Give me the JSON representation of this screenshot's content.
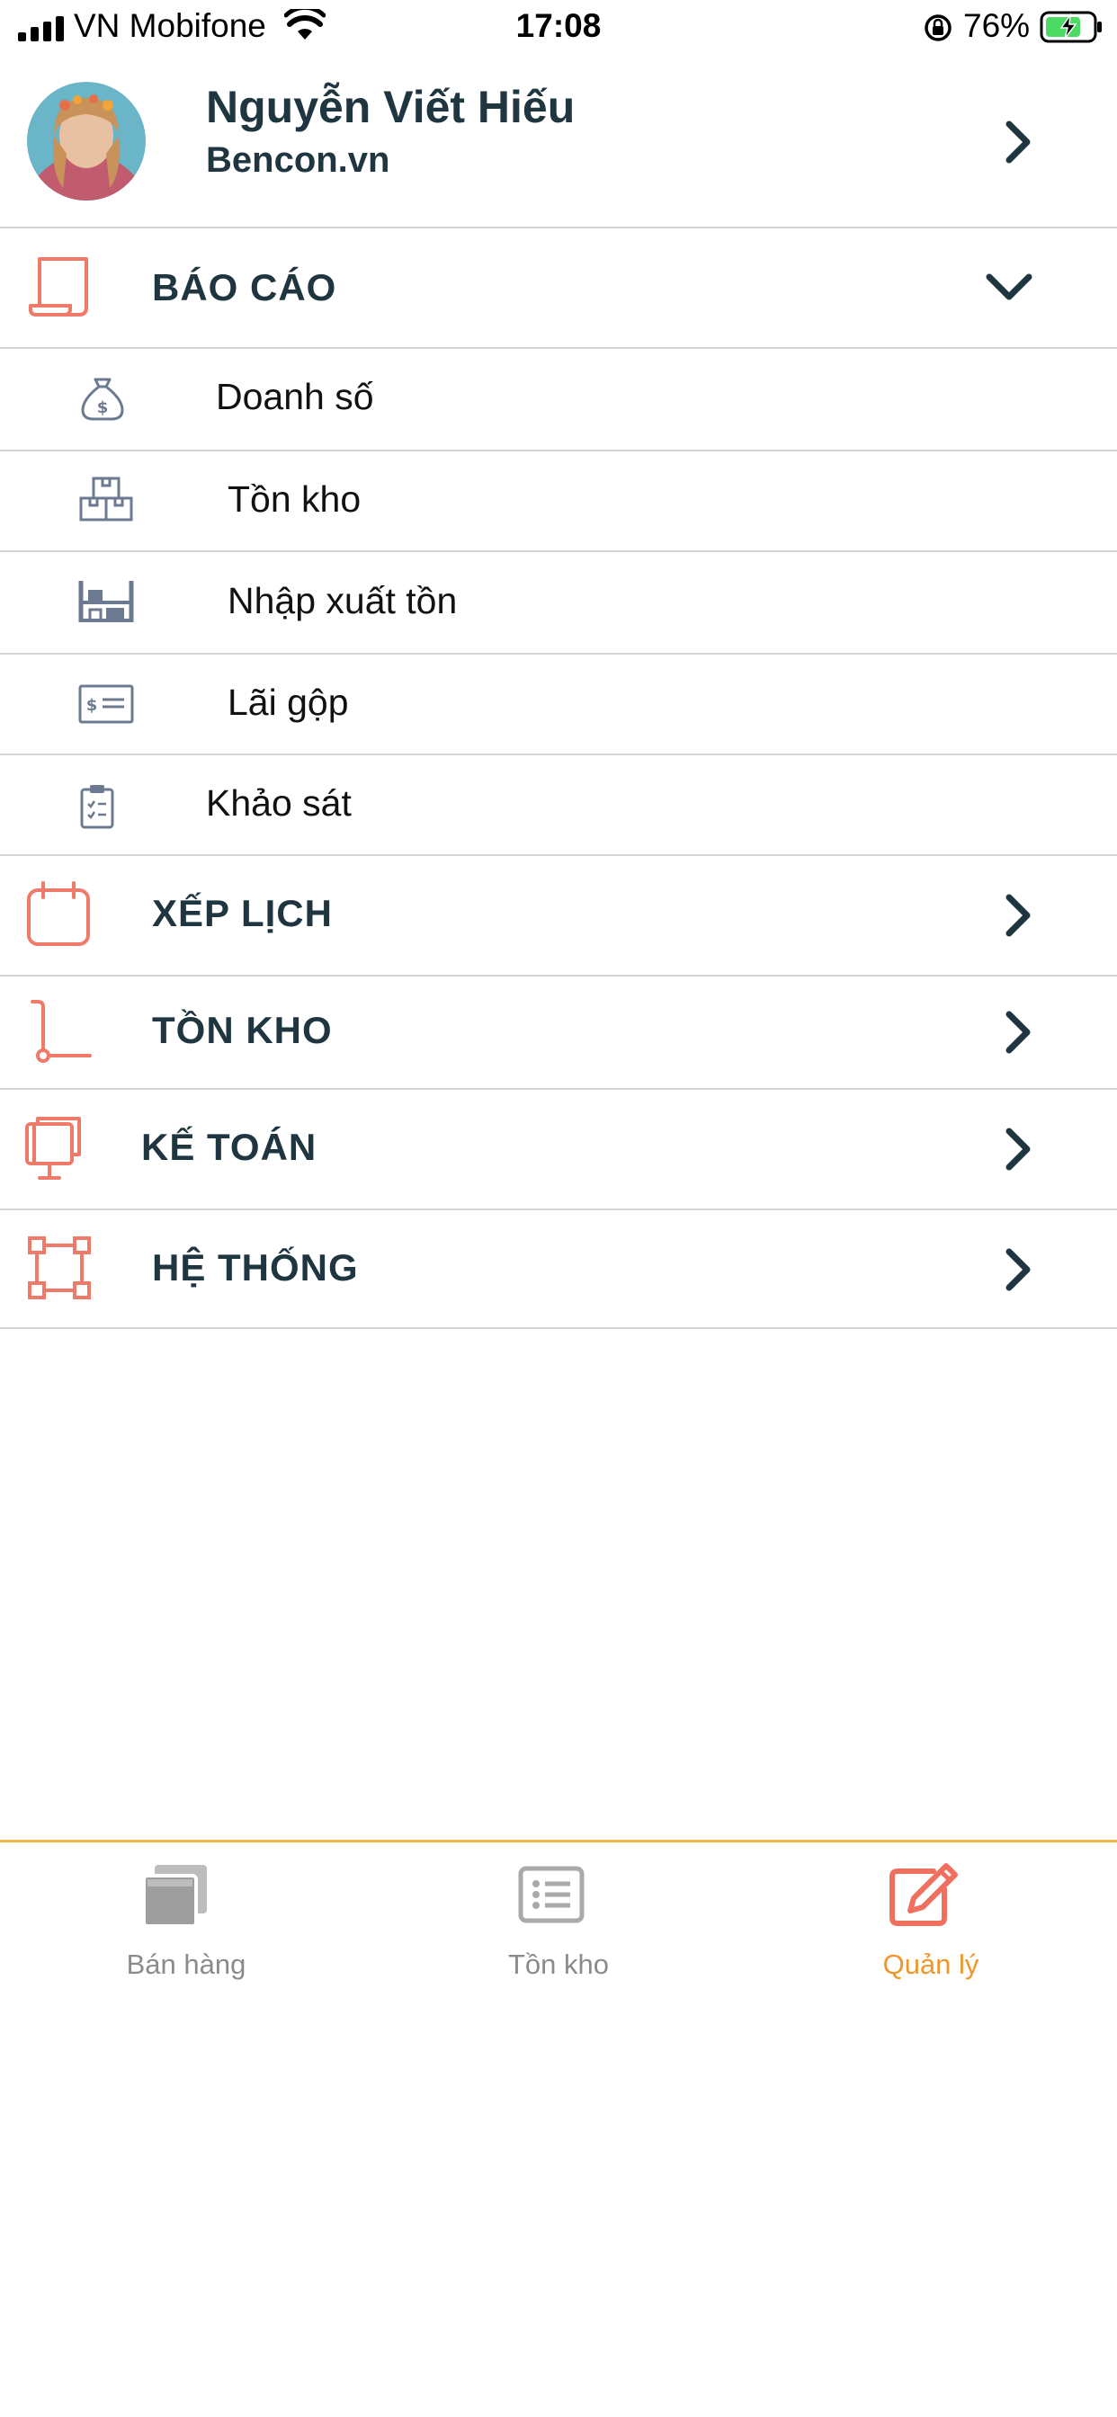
{
  "status_bar": {
    "carrier": "VN Mobifone",
    "time": "17:08",
    "battery": "76%"
  },
  "profile": {
    "name": "Nguyễn Viết Hiếu",
    "company": "Bencon.vn"
  },
  "menu": {
    "bao_cao": {
      "label": "BÁO CÁO",
      "expanded": true,
      "items": [
        {
          "label": "Doanh số",
          "icon": "money-bag-icon"
        },
        {
          "label": "Tồn kho",
          "icon": "boxes-icon"
        },
        {
          "label": "Nhập xuất tồn",
          "icon": "warehouse-shelf-icon"
        },
        {
          "label": "Lãi gộp",
          "icon": "profit-card-icon"
        },
        {
          "label": "Khảo sát",
          "icon": "clipboard-icon"
        }
      ]
    },
    "sections": [
      {
        "label": "XẾP LỊCH",
        "icon": "calendar-icon"
      },
      {
        "label": "TỒN KHO",
        "icon": "hand-truck-icon"
      },
      {
        "label": "KẾ TOÁN",
        "icon": "accounting-desk-icon"
      },
      {
        "label": "HỆ THỐNG",
        "icon": "system-nodes-icon"
      }
    ]
  },
  "tabbar": {
    "tabs": [
      {
        "label": "Bán hàng",
        "icon": "sales-windows-icon",
        "active": false
      },
      {
        "label": "Tồn kho",
        "icon": "list-icon",
        "active": false
      },
      {
        "label": "Quản lý",
        "icon": "edit-icon",
        "active": true
      }
    ]
  },
  "colors": {
    "accent_icon": "#f07a6a",
    "text_dark": "#1f3540",
    "tab_active": "#f0962a",
    "tab_divider": "#f0b84a",
    "sub_icon": "#6b7a90"
  }
}
